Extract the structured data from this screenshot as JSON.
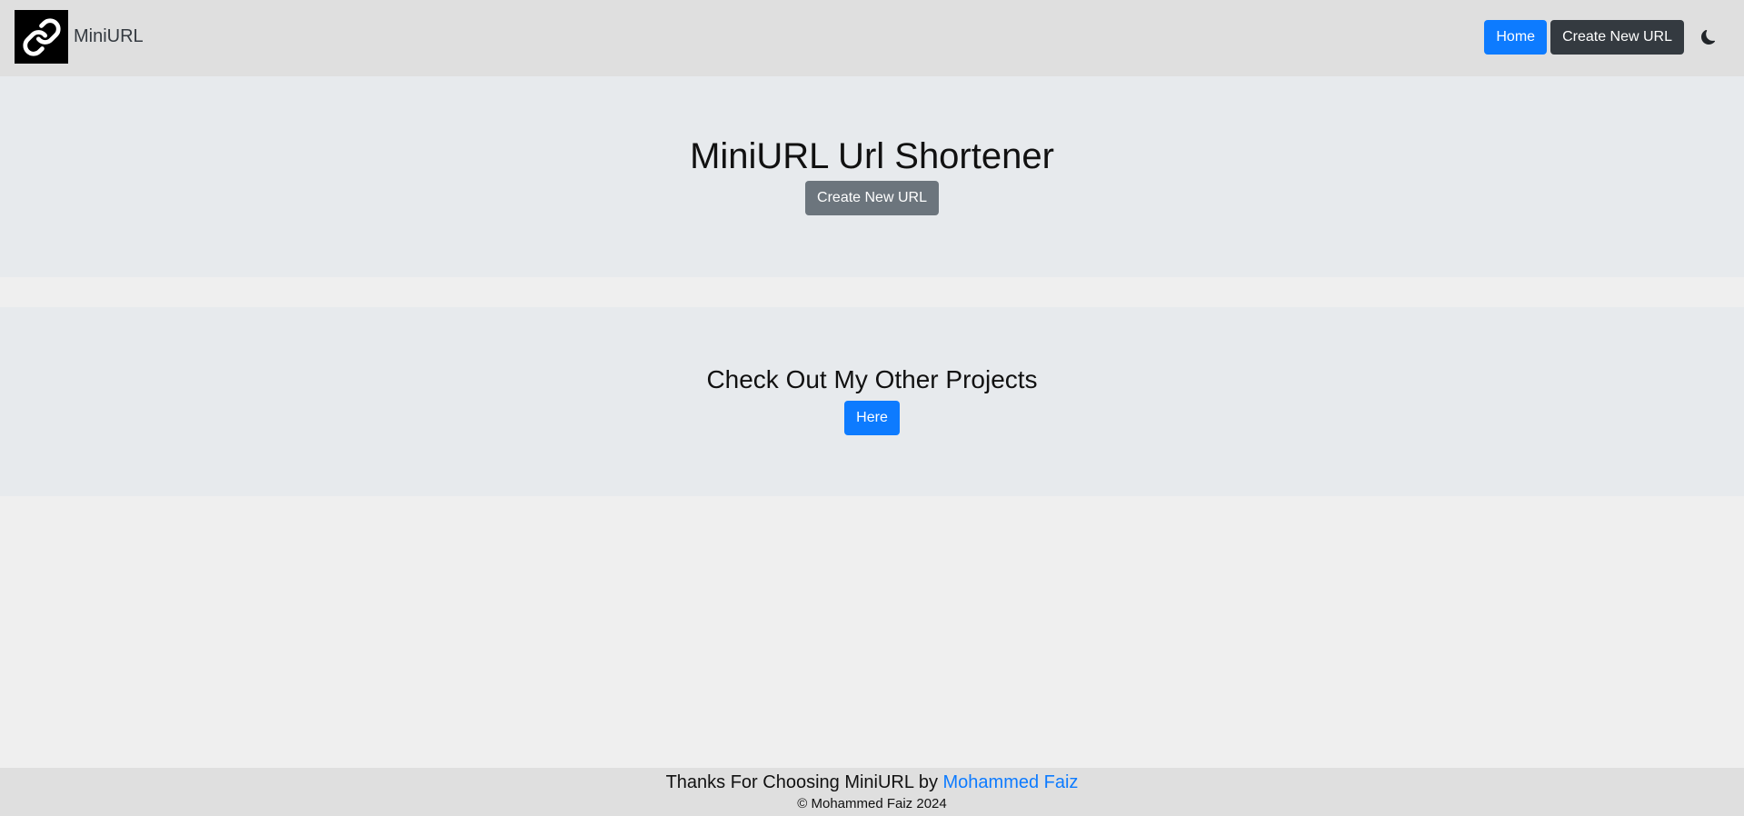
{
  "navbar": {
    "brand_name": "MiniURL",
    "logo_icon": "link-icon",
    "home_label": "Home",
    "create_label": "Create New URL",
    "theme_icon": "moon-icon"
  },
  "hero": {
    "title": "MiniURL Url Shortener",
    "button_label": "Create New URL"
  },
  "projects": {
    "title": "Check Out My Other Projects",
    "button_label": "Here"
  },
  "footer": {
    "thanks_text": "Thanks For Choosing MiniURL by ",
    "author_link": "Mohammed Faiz",
    "copyright": "© Mohammed Faiz 2024"
  },
  "colors": {
    "primary": "#0d7bff",
    "dark": "#343a40",
    "secondary": "#6c757d",
    "navbar_bg": "#dfdfdf",
    "section_bg": "#e7eaed",
    "page_bg": "#efefef"
  }
}
